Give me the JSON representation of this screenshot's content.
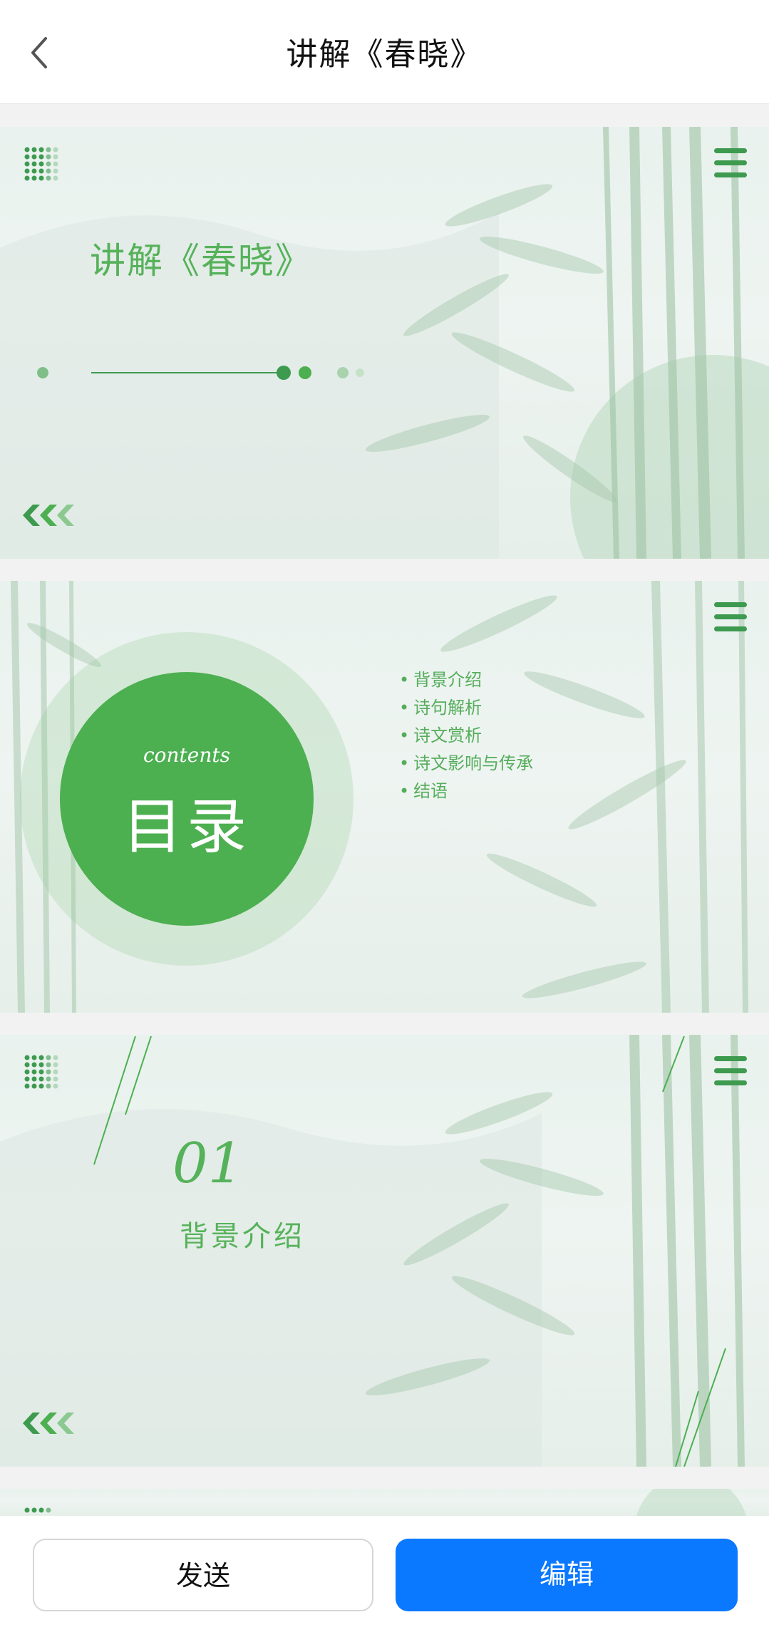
{
  "header": {
    "title": "讲解《春晓》",
    "back_icon": "chevron-left-icon"
  },
  "slides": [
    {
      "title": "讲解《春晓》"
    },
    {
      "contents_label": "contents",
      "heading": "目录",
      "toc": [
        "背景介绍",
        "诗句解析",
        "诗文赏析",
        "诗文影响与传承",
        "结语"
      ]
    },
    {
      "number": "01",
      "section": "背景介绍"
    }
  ],
  "footer": {
    "send_label": "发送",
    "edit_label": "编辑"
  },
  "colors": {
    "accent_green": "#4caf50",
    "primary_blue": "#0a78ff"
  }
}
